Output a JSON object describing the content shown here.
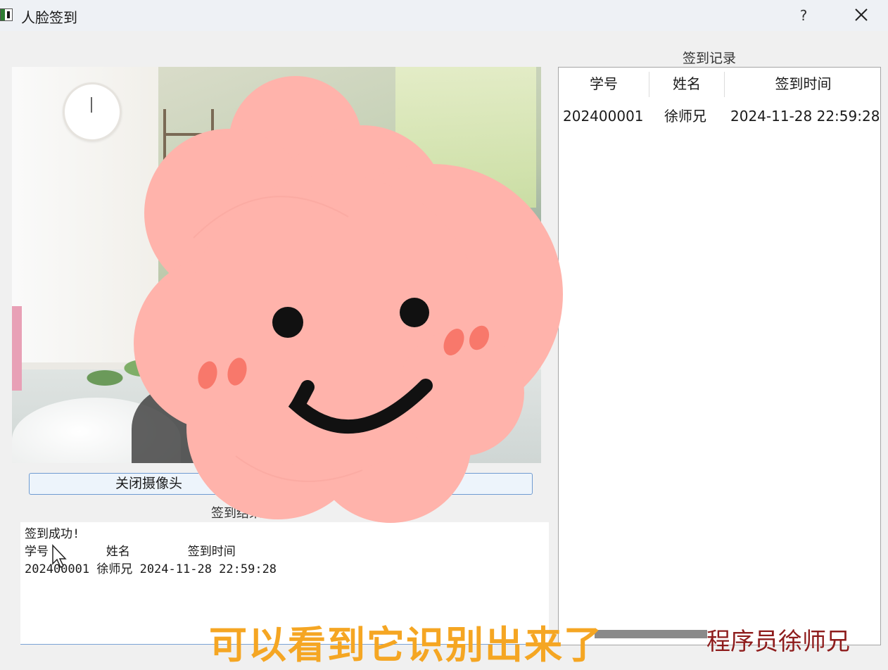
{
  "window": {
    "title": "人脸签到",
    "help_label": "?"
  },
  "camera": {
    "button_label": "关闭摄像头"
  },
  "result": {
    "label": "签到结果",
    "log_lines": [
      "签到成功!",
      "学号        姓名        签到时间",
      "202400001 徐师兄 2024-11-28 22:59:28"
    ]
  },
  "records": {
    "label": "签到记录",
    "columns": [
      "学号",
      "姓名",
      "签到时间"
    ],
    "rows": [
      [
        "202400001",
        "徐师兄",
        "2024-11-28 22:59:28"
      ]
    ]
  },
  "overlay": {
    "subtitle": "可以看到它识别出来了",
    "watermark": "程序员徐师兄",
    "subtitle_color": "#f5a623",
    "watermark_color": "#8e1c1c",
    "sticker_color": "#ffb3ab"
  }
}
